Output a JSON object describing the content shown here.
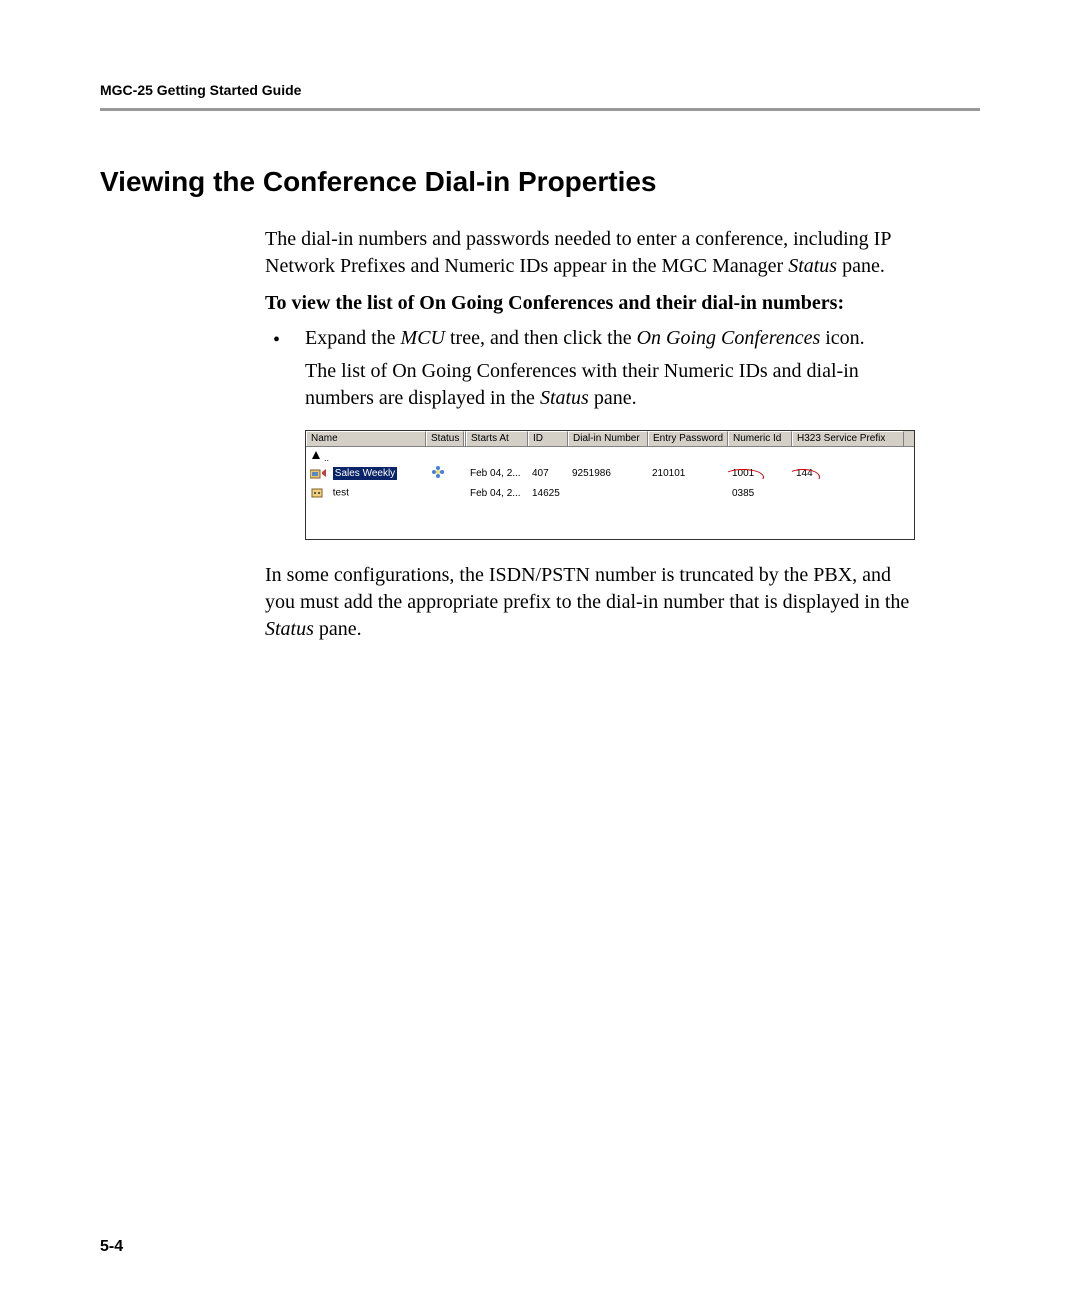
{
  "header": {
    "guide_title": "MGC-25 Getting Started Guide"
  },
  "section": {
    "title": "Viewing the Conference Dial-in Properties",
    "intro": "The dial-in numbers and passwords needed to enter a conference, including IP Network Prefixes and Numeric IDs appear in the MGC Manager ",
    "intro_italic": "Status",
    "intro_end": " pane.",
    "subheading": "To view the list of On Going Conferences and their dial-in numbers:",
    "bullet": {
      "text_1": "Expand the ",
      "italic_1": "MCU",
      "text_2": " tree, and then click the ",
      "italic_2": "On Going Conferences",
      "text_3": " icon."
    },
    "sub_paragraph": {
      "text_1": "The list of On Going Conferences with their Numeric IDs and dial-in numbers are displayed in the ",
      "italic_1": "Status",
      "text_2": " pane."
    },
    "note": {
      "text_1": "In some configurations, the ISDN/PSTN number is truncated by the PBX, and you must add the appropriate prefix to the dial-in number that is displayed in the ",
      "italic_1": "Status",
      "text_2": " pane."
    }
  },
  "table": {
    "headers": {
      "name": "Name",
      "status": "Status",
      "starts_at": "Starts At",
      "id": "ID",
      "dialin": "Dial-in Number",
      "entry": "Entry Password",
      "numeric": "Numeric Id",
      "h323": "H323 Service Prefix"
    },
    "rows": [
      {
        "name": "Sales Weekly",
        "starts_at": "Feb 04, 2...",
        "id": "407",
        "dialin": "9251986",
        "entry": "210101",
        "numeric": "1001",
        "h323": "144"
      },
      {
        "name": "test",
        "starts_at": "Feb 04, 2...",
        "id": "14625",
        "dialin": "",
        "entry": "",
        "numeric": "0385",
        "h323": ""
      }
    ]
  },
  "page_number": "5-4"
}
